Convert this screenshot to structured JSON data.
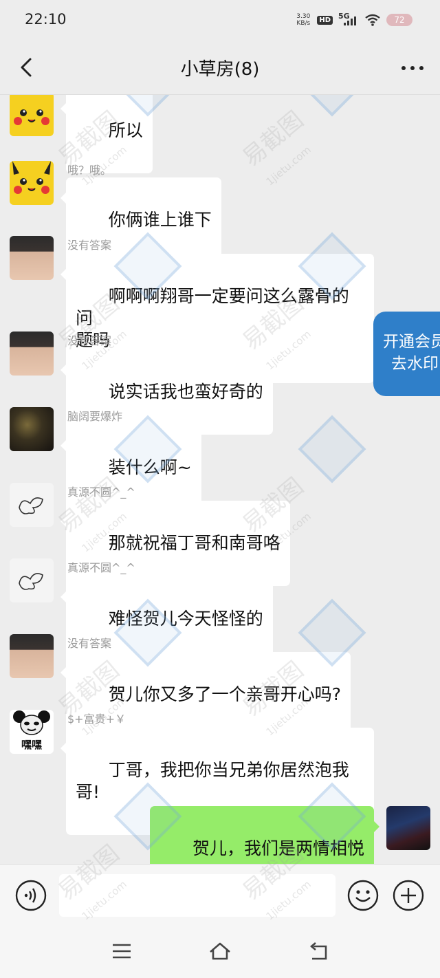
{
  "status_bar": {
    "time": "22:10",
    "net_speed_value": "3.30",
    "net_speed_unit": "KB/s",
    "hd": "HD",
    "network": "5G",
    "battery": "72"
  },
  "header": {
    "title": "小草房(8)"
  },
  "messages": [
    {
      "sender": "哦？哦。",
      "text": "所以",
      "avatar": "pikachu-avatar"
    },
    {
      "sender": "哦？哦。",
      "text": "你俩谁上谁下",
      "avatar": "pikachu-avatar"
    },
    {
      "sender": "没有答案",
      "text": "啊啊啊翔哥一定要问这么露骨的问\n题吗",
      "avatar": "boy-avatar"
    },
    {
      "sender": "没有答案",
      "text": "说实话我也蛮好奇的",
      "avatar": "boy-avatar"
    },
    {
      "sender": "脑阔要爆炸",
      "text": "装什么啊~",
      "avatar": "dark-avatar"
    },
    {
      "sender": "真源不圆^_^",
      "text": "那就祝福丁哥和南哥咯",
      "avatar": "sketch-avatar"
    },
    {
      "sender": "真源不圆^_^",
      "text": "难怪贺儿今天怪怪的",
      "avatar": "sketch-avatar"
    },
    {
      "sender": "没有答案",
      "text": "贺儿你又多了一个亲哥开心吗?",
      "avatar": "boy-avatar"
    },
    {
      "sender": "$+富贵+￥",
      "text": "丁哥，我把你当兄弟你居然泡我\n哥!",
      "avatar": "panda-meme-avatar",
      "avatar_text": "嘿嘿"
    },
    {
      "sender": "",
      "text": "贺儿，我们是两情相悦",
      "avatar": "self-avatar",
      "mine": true
    }
  ],
  "vip_tab": {
    "line1": "开通会员",
    "line2": "去水印"
  },
  "watermark": {
    "text": "易截图",
    "url": "1jietu.com"
  },
  "input": {
    "value": "",
    "placeholder": ""
  },
  "colors": {
    "background": "#ededed",
    "bubble_other": "#ffffff",
    "bubble_mine": "#95ec69",
    "vip": "#2f7fc9"
  },
  "icons": [
    "back-icon",
    "more-icon",
    "voice-icon",
    "emoji-icon",
    "plus-icon",
    "menu-icon",
    "home-icon",
    "return-icon"
  ]
}
